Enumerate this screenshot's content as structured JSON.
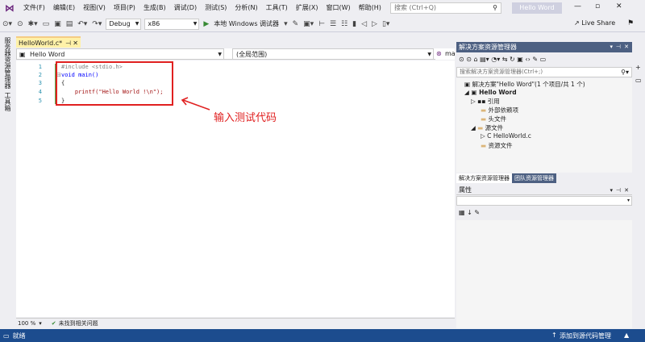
{
  "menu": {
    "items": [
      "文件(F)",
      "编辑(E)",
      "视图(V)",
      "项目(P)",
      "生成(B)",
      "调试(D)",
      "测试(S)",
      "分析(N)",
      "工具(T)",
      "扩展(X)",
      "窗口(W)",
      "帮助(H)"
    ],
    "search_placeholder": "搜索 (Ctrl+Q)",
    "project_badge": "Hello Word"
  },
  "toolbar": {
    "config": "Debug",
    "platform": "x86",
    "run_label": "本地 Windows 调试器",
    "live_share": "Live Share"
  },
  "left_rail": [
    "服务器资源管理器",
    "工具箱"
  ],
  "editor": {
    "tab_title": "HelloWorld.c*",
    "nav_project": "Hello Word",
    "nav_scope": "(全局范围)",
    "nav_member": "main",
    "lines": [
      {
        "num": "1",
        "text": "#include <stdio.h>"
      },
      {
        "num": "2",
        "text": "void main()"
      },
      {
        "num": "3",
        "text": "{"
      },
      {
        "num": "4",
        "text": "    printf(\"Hello World !\\n\");"
      },
      {
        "num": "5",
        "text": "}"
      }
    ],
    "zoom": "100 %",
    "issues": "未找到相关问题"
  },
  "annotation": {
    "text": "输入测试代码"
  },
  "solution_explorer": {
    "title": "解决方案资源管理器",
    "search_placeholder": "搜索解决方案资源管理器(Ctrl+;)",
    "tree": [
      "解决方案\"Hello Word\"(1 个项目/共 1 个)",
      "Hello Word",
      "引用",
      "外部依赖项",
      "头文件",
      "源文件",
      "HelloWorld.c",
      "资源文件"
    ],
    "tabs": [
      "解决方案资源管理器",
      "团队资源管理器"
    ]
  },
  "properties": {
    "title": "属性"
  },
  "status": {
    "left": "就绪",
    "right": "添加到源代码管理"
  },
  "colors": {
    "statusbar": "#1c4c8e",
    "panel_title": "#4d6082",
    "annotation": "#e02020"
  }
}
